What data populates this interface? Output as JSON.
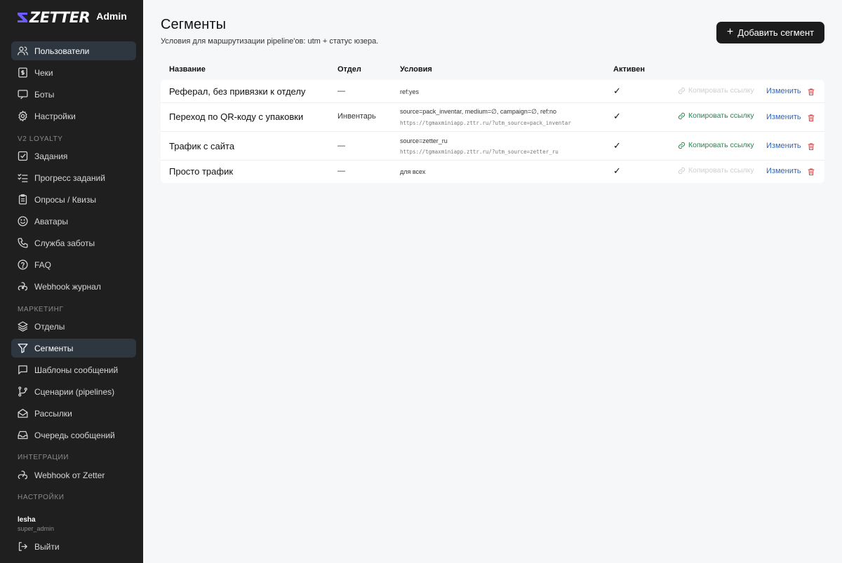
{
  "brand": {
    "name": "ZETTER",
    "badge": "Admin",
    "accent": "#6a5cff"
  },
  "sidebar": {
    "top_items": [
      {
        "label": "Пользователи",
        "icon": "users-icon",
        "active": true
      },
      {
        "label": "Чеки",
        "icon": "receipt-icon"
      },
      {
        "label": "Боты",
        "icon": "message-icon"
      },
      {
        "label": "Настройки",
        "icon": "gear-icon"
      }
    ],
    "section_loyalty": "V2 LOYALTY",
    "loyalty_items": [
      {
        "label": "Задания",
        "icon": "checkbox-icon"
      },
      {
        "label": "Прогресс заданий",
        "icon": "list-check-icon"
      },
      {
        "label": "Опросы / Квизы",
        "icon": "clipboard-icon"
      },
      {
        "label": "Аватары",
        "icon": "smile-icon"
      },
      {
        "label": "Служба заботы",
        "icon": "phone-icon"
      },
      {
        "label": "FAQ",
        "icon": "help-circle-icon"
      },
      {
        "label": "Webhook журнал",
        "icon": "webhook-icon"
      }
    ],
    "section_marketing": "МАРКЕТИНГ",
    "marketing_items": [
      {
        "label": "Отделы",
        "icon": "layers-icon"
      },
      {
        "label": "Сегменты",
        "icon": "filter-icon",
        "active": true
      },
      {
        "label": "Шаблоны сообщений",
        "icon": "message-square-icon"
      },
      {
        "label": "Сценарии (pipelines)",
        "icon": "git-branch-icon"
      },
      {
        "label": "Рассылки",
        "icon": "mail-open-icon"
      },
      {
        "label": "Очередь сообщений",
        "icon": "inbox-icon"
      }
    ],
    "section_integrations": "ИНТЕГРАЦИИ",
    "integration_items": [
      {
        "label": "Webhook от Zetter",
        "icon": "key-icon"
      }
    ],
    "section_settings": "НАСТРОЙКИ",
    "user": {
      "name": "lesha",
      "role": "super_admin"
    },
    "logout_label": "Выйти"
  },
  "page": {
    "title": "Сегменты",
    "subtitle": "Условия для маршрутизации pipeline'ов: utm + статус юзера.",
    "add_button": "Добавить сегмент"
  },
  "table": {
    "columns": [
      "Название",
      "Отдел",
      "Условия",
      "Активен"
    ],
    "rows": [
      {
        "name": "Реферал, без привязки к отделу",
        "dept": "—",
        "conditions": "ref:yes",
        "link": "",
        "active": "✓",
        "copy": "Копировать ссылку",
        "copy_enabled": false,
        "edit": "Изменить"
      },
      {
        "name": "Переход по QR-коду с упаковки",
        "dept": "Инвентарь",
        "conditions": "source=pack_inventar, medium=∅, campaign=∅, ref:no",
        "link": "https://tgmaxminiapp.zttr.ru/?utm_source=pack_inventar",
        "active": "✓",
        "copy": "Копировать ссылку",
        "copy_enabled": true,
        "edit": "Изменить"
      },
      {
        "name": "Трафик с сайта",
        "dept": "—",
        "conditions": "source=zetter_ru",
        "link": "https://tgmaxminiapp.zttr.ru/?utm_source=zetter_ru",
        "active": "✓",
        "copy": "Копировать ссылку",
        "copy_enabled": true,
        "edit": "Изменить"
      },
      {
        "name": "Просто трафик",
        "dept": "—",
        "conditions": "для всех",
        "link": "",
        "active": "✓",
        "copy": "Копировать ссылку",
        "copy_enabled": false,
        "edit": "Изменить"
      }
    ]
  },
  "colors": {
    "sidebar_bg": "#1f1f1f",
    "active_bg": "#2e3640",
    "copy_green": "#1f8a4c",
    "edit_blue": "#2c67c6",
    "delete_red": "#d64545"
  }
}
